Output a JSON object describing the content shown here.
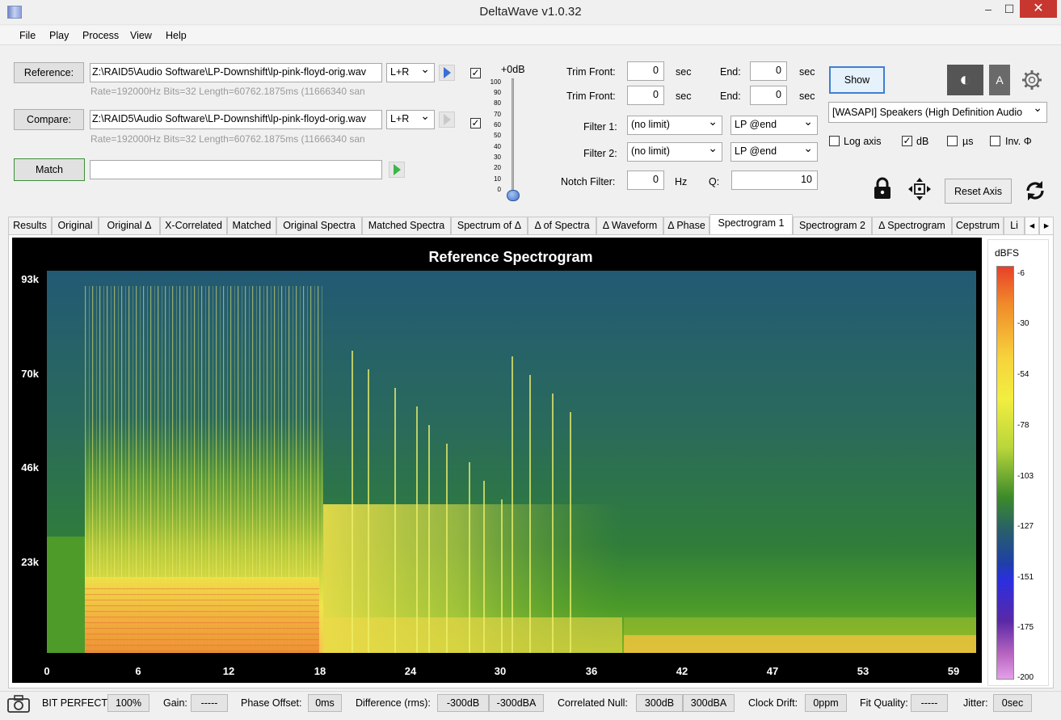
{
  "window": {
    "title": "DeltaWave v1.0.32",
    "min": "–",
    "max": "☐",
    "close": "✕"
  },
  "menu": [
    "File",
    "Play",
    "Process",
    "View",
    "Help"
  ],
  "files": {
    "reference_label": "Reference:",
    "reference_path": "Z:\\RAID5\\Audio Software\\LP-Downshift\\lp-pink-floyd-orig.wav",
    "reference_channel": "L+R",
    "reference_info": "Rate=192000Hz Bits=32 Length=60762.1875ms (11666340 san",
    "compare_label": "Compare:",
    "compare_path": "Z:\\RAID5\\Audio Software\\LP-Downshift\\lp-pink-floyd-orig.wav",
    "compare_channel": "L+R",
    "compare_info": "Rate=192000Hz Bits=32 Length=60762.1875ms (11666340 san",
    "match_label": "Match",
    "match_value": ""
  },
  "volume": {
    "label": "+0dB",
    "ticks": [
      "100",
      "90",
      "80",
      "70",
      "60",
      "50",
      "40",
      "30",
      "20",
      "10",
      "0"
    ]
  },
  "trim": {
    "front_label": "Trim Front:",
    "end_label": "End:",
    "unit": "sec",
    "row1_front": "0",
    "row1_end": "0",
    "row2_front": "0",
    "row2_end": "0"
  },
  "filters": {
    "filter1_label": "Filter 1:",
    "filter1_value": "(no limit)",
    "filter1_mode": "LP @end",
    "filter2_label": "Filter 2:",
    "filter2_value": "(no limit)",
    "filter2_mode": "LP @end",
    "notch_label": "Notch Filter:",
    "notch_value": "0",
    "notch_unit": "Hz",
    "q_label": "Q:",
    "q_value": "10"
  },
  "output": {
    "show_label": "Show",
    "device": "[WASAPI] Speakers (High Definition Audio",
    "log_axis": "Log axis",
    "db": "dB",
    "us": "µs",
    "inv_phi": "Inv. Φ",
    "contrast_icon": "◐",
    "a_button": "A",
    "reset_axis": "Reset Axis"
  },
  "tabs": [
    "Results",
    "Original",
    "Original Δ",
    "X-Correlated",
    "Matched",
    "Original Spectra",
    "Matched Spectra",
    "Spectrum of Δ",
    "Δ of Spectra",
    "Δ Waveform",
    "Δ Phase",
    "Spectrogram 1",
    "Spectrogram 2",
    "Δ Spectrogram",
    "Cepstrum",
    "Li"
  ],
  "active_tab": "Spectrogram 1",
  "chart_data": {
    "type": "heatmap",
    "title": "Reference Spectrogram",
    "x_ticks": [
      "0",
      "6",
      "12",
      "18",
      "24",
      "30",
      "36",
      "42",
      "47",
      "53",
      "59"
    ],
    "y_ticks": [
      "93k",
      "70k",
      "46k",
      "23k"
    ],
    "colorbar_label": "dBFS",
    "colorbar_ticks": [
      "-6",
      "-30",
      "-54",
      "-78",
      "-103",
      "-127",
      "-151",
      "-175",
      "-200"
    ],
    "colors": {
      "low": "#1e4a8c",
      "mid": "#2f8a2a",
      "high": "#f2ea3a",
      "peak": "#e8401c"
    }
  },
  "status": {
    "bit_perfect": "BIT PERFECT!",
    "bit_value": "100%",
    "gain_label": "Gain:",
    "gain_value": "-----",
    "phase_label": "Phase Offset:",
    "phase_value": "0ms",
    "diff_label": "Difference (rms):",
    "diff_db": "-300dB",
    "diff_dba": "-300dBA",
    "null_label": "Correlated Null:",
    "null_db": "300dB",
    "null_dba": "300dBA",
    "drift_label": "Clock Drift:",
    "drift_value": "0ppm",
    "fit_label": "Fit Quality:",
    "fit_value": "-----",
    "jitter_label": "Jitter:",
    "jitter_value": "0sec"
  }
}
